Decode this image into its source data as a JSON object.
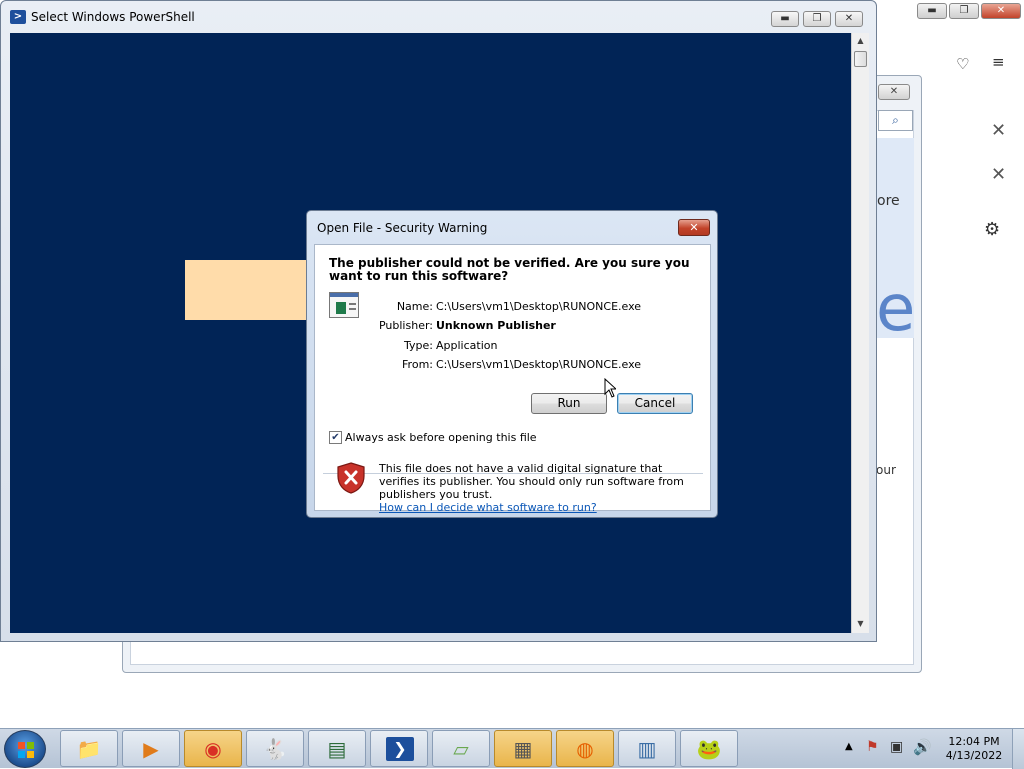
{
  "background_app": {
    "partial_text_ore": "ore",
    "partial_text_our": "our",
    "big_letter": "e"
  },
  "powershell": {
    "title": "Select Windows PowerShell",
    "console_color": "#012456"
  },
  "dialog": {
    "title": "Open File - Security Warning",
    "question": "The publisher could not be verified.  Are you sure you want to run this software?",
    "fields": [
      {
        "label": "Name:",
        "value": "C:\\Users\\vm1\\Desktop\\RUNONCE.exe"
      },
      {
        "label": "Publisher:",
        "value": "Unknown Publisher"
      },
      {
        "label": "Type:",
        "value": "Application"
      },
      {
        "label": "From:",
        "value": "C:\\Users\\vm1\\Desktop\\RUNONCE.exe"
      }
    ],
    "run_label": "Run",
    "cancel_label": "Cancel",
    "checkbox_label": "Always ask before opening this file",
    "checkbox_checked": true,
    "warning_text": "This file does not have a valid digital signature that verifies its publisher.  You should only run software from publishers you trust.",
    "help_link": "How can I decide what software to run?"
  },
  "taskbar": {
    "items": [
      {
        "name": "file-explorer",
        "glyph": "📁"
      },
      {
        "name": "media-player",
        "glyph": "▶"
      },
      {
        "name": "chrome",
        "glyph": "◉"
      },
      {
        "name": "bunny-app",
        "glyph": "🐇"
      },
      {
        "name": "monitor-app",
        "glyph": "▤"
      },
      {
        "name": "powershell",
        "glyph": "❯"
      },
      {
        "name": "sticky-notes",
        "glyph": "▱"
      },
      {
        "name": "calculator",
        "glyph": "▦"
      },
      {
        "name": "firefox",
        "glyph": "◍"
      },
      {
        "name": "book-app",
        "glyph": "▥"
      },
      {
        "name": "frog-app",
        "glyph": "🐸"
      }
    ],
    "time": "12:04 PM",
    "date": "4/13/2022"
  }
}
